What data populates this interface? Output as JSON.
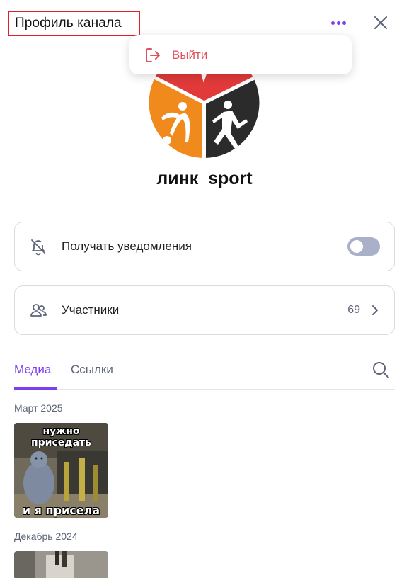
{
  "header": {
    "title": "Профиль канала",
    "more_icon": "more-horizontal-icon",
    "close_icon": "close-icon"
  },
  "menu": {
    "items": [
      {
        "label": "Выйти",
        "icon": "logout-icon",
        "color": "#e0525b"
      }
    ]
  },
  "channel": {
    "name": "линк_sport",
    "avatar_icon": "sport-logo"
  },
  "settings": {
    "notifications": {
      "label": "Получать уведомления",
      "icon": "bell-off-icon",
      "enabled": false
    },
    "members": {
      "label": "Участники",
      "icon": "users-icon",
      "count": "69"
    }
  },
  "tabs": {
    "items": [
      {
        "label": "Медиа",
        "active": true
      },
      {
        "label": "Ссылки",
        "active": false
      }
    ],
    "search_icon": "search-icon"
  },
  "media": {
    "groups": [
      {
        "month": "Март 2025",
        "caption_top": "нужно приседать",
        "caption_bottom": "и я присела"
      },
      {
        "month": "Декабрь 2024"
      }
    ]
  },
  "colors": {
    "accent": "#7b3ff2",
    "danger": "#e0525b",
    "highlight_border": "#e0202a",
    "toggle_off": "#a9b0c8"
  }
}
